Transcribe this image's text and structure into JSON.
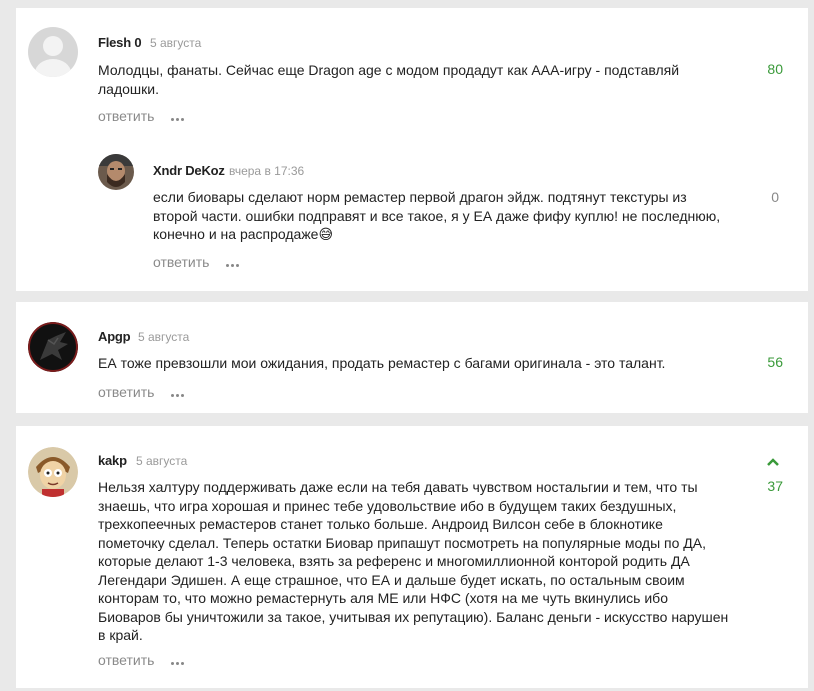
{
  "colors": {
    "background": "#e9e9e9",
    "card": "#ffffff",
    "positive_score": "#3a9a3a",
    "neutral_score": "#888888",
    "muted_text": "#9a9a9a"
  },
  "comments": [
    {
      "author": "Flesh 0",
      "date": "5 августа",
      "text_lines": [
        "Молодцы, фанаты. Сейчас еще Dragon age с модом продадут как ААА-игру - подставляй",
        "ладошки."
      ],
      "reply_label": "ответить",
      "score": "80",
      "avatar_icon": "default-user-avatar-icon",
      "replies": [
        {
          "author": "Xndr DeKoz",
          "date": "вчера в 17:36",
          "text_lines": [
            "если биовары сделают норм ремастер первой драгон эйдж. подтянут текстуры из",
            "второй части. ошибки подправят и все такое, я у ЕА даже фифу куплю! не последнюю,",
            "конечно и на распродаже"
          ],
          "emoji": "😅",
          "reply_label": "ответить",
          "score": "0",
          "avatar_icon": "bearded-man-avatar-icon"
        }
      ]
    },
    {
      "author": "Apgp",
      "date": "5 августа",
      "text_lines": [
        "ЕА тоже превзошли мои ожидания, продать ремастер с багами оригинала - это талант."
      ],
      "reply_label": "ответить",
      "score": "56",
      "avatar_icon": "dark-dragon-avatar-icon"
    },
    {
      "author": "kakp",
      "date": "5 августа",
      "text_lines": [
        "Нельзя халтуру поддерживать даже если на тебя давать чувством ностальгии и тем, что ты",
        "знаешь, что игра хорошая и принес тебе удовольствие ибо в будущем таких бездушных,",
        "трехкопеечных ремастеров станет только больше. Андроид Вилсон себе в блокнотике",
        "пометочку сделал. Теперь остатки Биовар припашут посмотреть на популярные моды по ДА,",
        "которые делают 1-3 человека, взять за референс и многомиллионной конторой родить ДА",
        "Легендари Эдишен. А еще страшное, что ЕА и дальше будет искать, по остальным своим",
        "конторам то, что можно ремастернуть аля МЕ или НФС (хотя на ме чуть вкинулись ибо",
        "Биоваров бы уничтожили за такое, учитывая их репутацию). Баланс деньги - искусство нарушен",
        "в край."
      ],
      "reply_label": "ответить",
      "score": "37",
      "avatar_icon": "cartoon-character-avatar-icon"
    }
  ]
}
